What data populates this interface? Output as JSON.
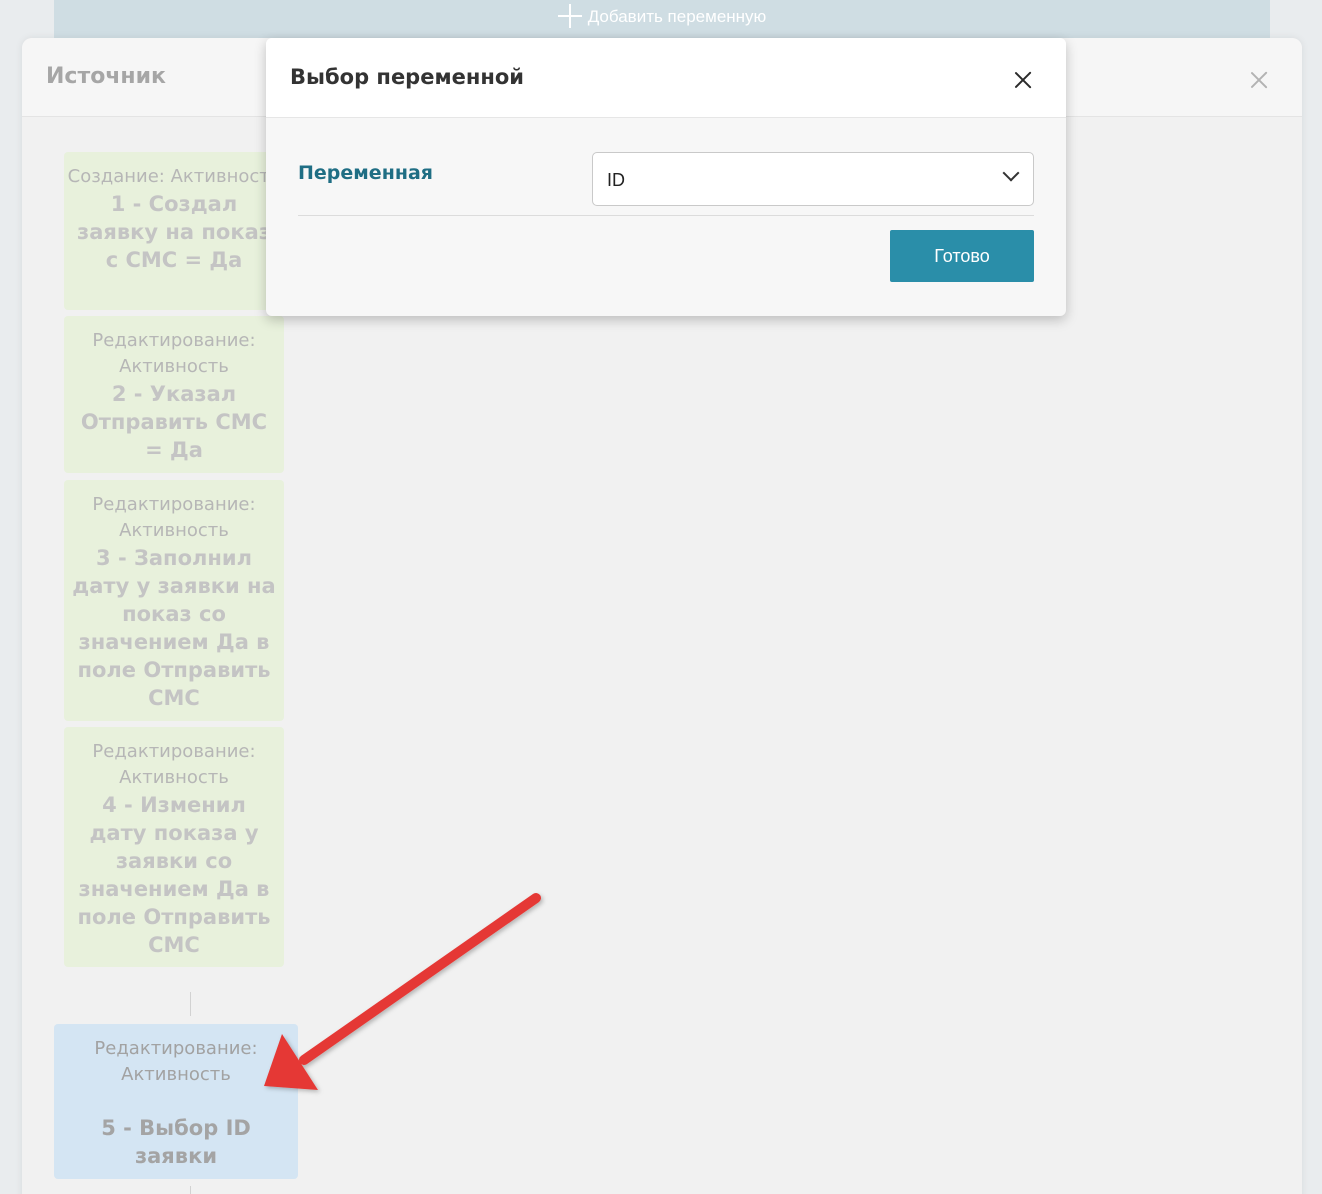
{
  "background": {
    "add_variable_label": "Добавить переменную"
  },
  "source_panel": {
    "title": "Источник",
    "cards": [
      {
        "type": "Создание: Активность",
        "name": "1 - Создал заявку на показ с СМС = Да"
      },
      {
        "type": "Редактирование: Активность",
        "name": "2 - Указал Отправить СМС = Да"
      },
      {
        "type": "Редактирование: Активность",
        "name": "3 - Заполнил дату у заявки на показ со значением Да в поле Отправить СМС"
      },
      {
        "type": "Редактирование: Активность",
        "name": "4 - Изменил дату показа у заявки со значением Да в поле Отправить СМС"
      },
      {
        "type": "Редактирование: Активность",
        "name": "5 - Выбор ID заявки"
      }
    ]
  },
  "modal": {
    "title": "Выбор переменной",
    "field_label": "Переменная",
    "select_value": "ID",
    "done_label": "Готово"
  },
  "colors": {
    "accent": "#2a8ea9",
    "label": "#1f6e84",
    "arrow": "#e53935",
    "card_green": "#e8f1dc",
    "card_blue": "#d4e5f3"
  }
}
